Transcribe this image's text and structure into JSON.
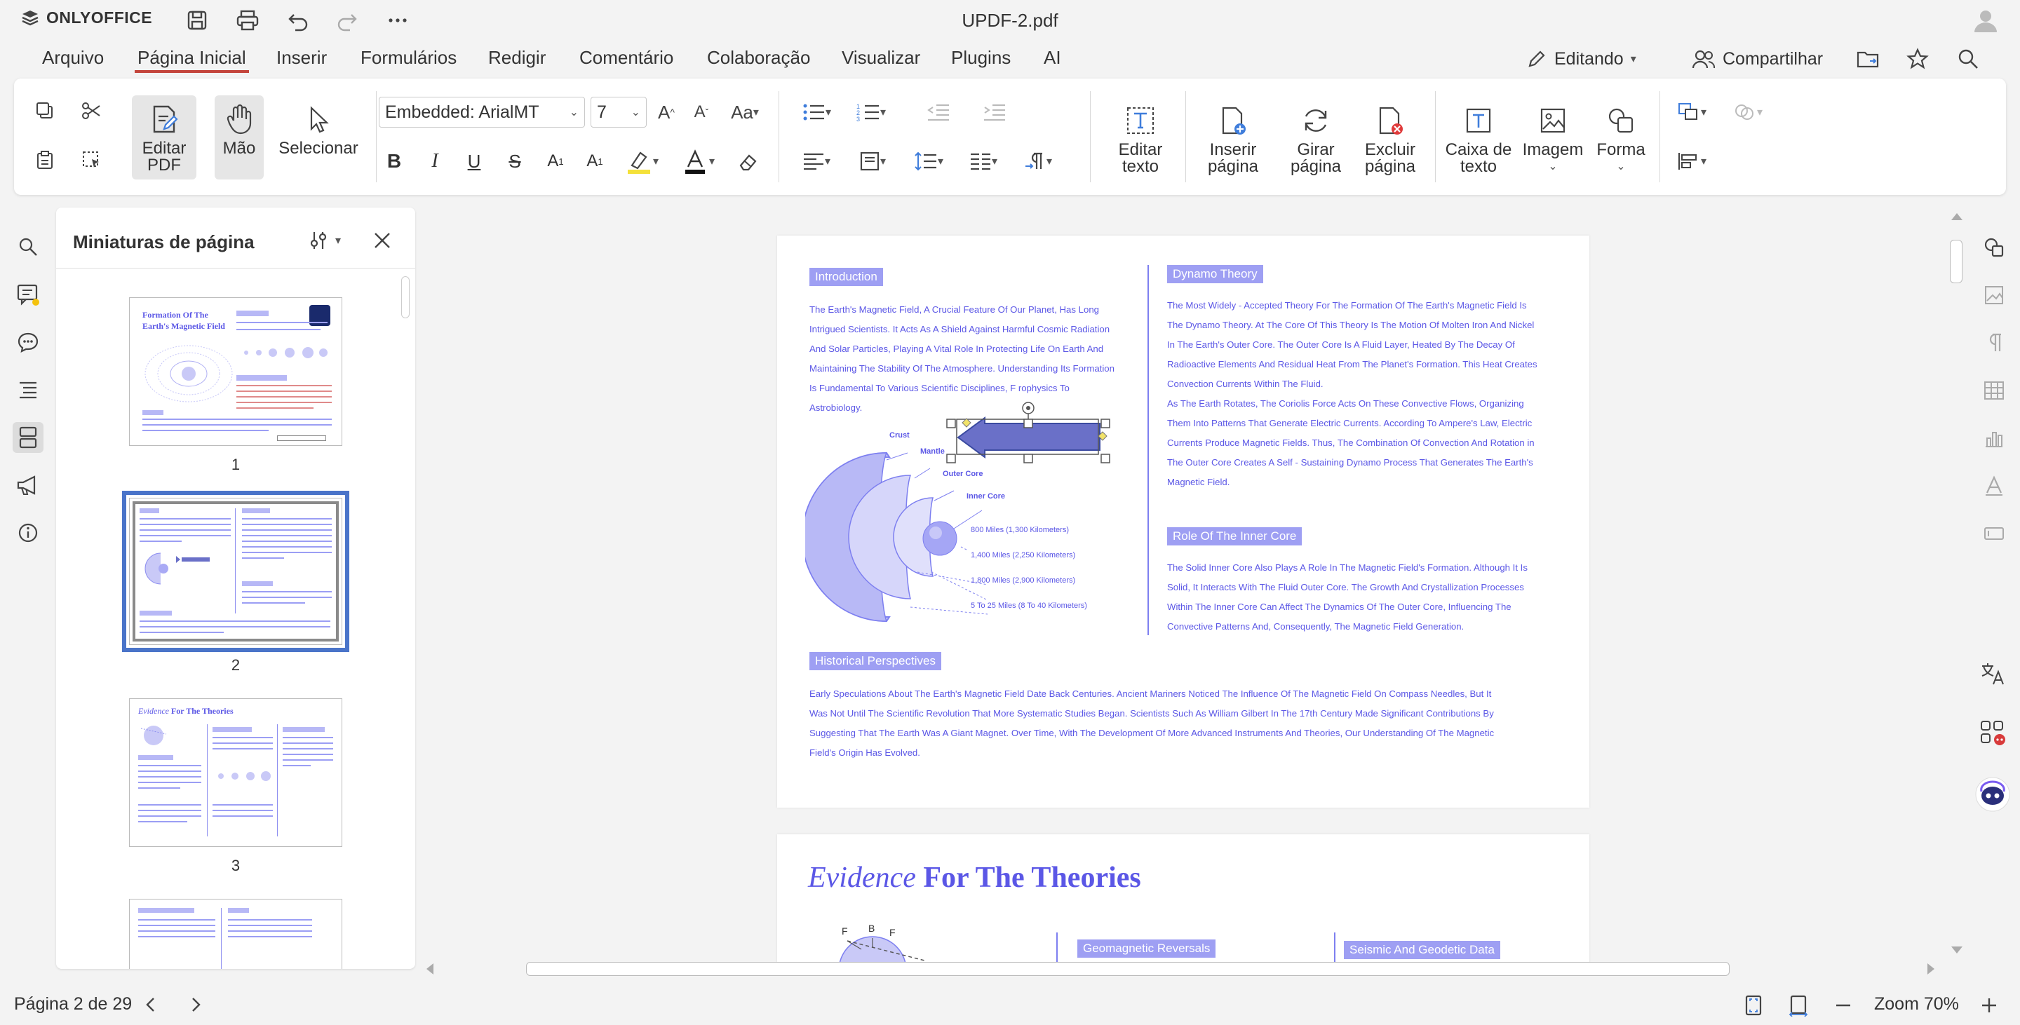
{
  "app": {
    "name": "ONLYOFFICE",
    "doc_title": "UPDF-2.pdf"
  },
  "menu": {
    "tabs": [
      "Arquivo",
      "Página Inicial",
      "Inserir",
      "Formulários",
      "Redigir",
      "Comentário",
      "Colaboração",
      "Visualizar",
      "Plugins",
      "AI"
    ],
    "active": "Página Inicial",
    "editing_label": "Editando",
    "share_label": "Compartilhar"
  },
  "ribbon": {
    "edit_pdf": "Editar PDF",
    "hand": "Mão",
    "select": "Selecionar",
    "font_name": "Embedded: ArialMT",
    "font_size": "7",
    "edit_text": "Editar texto",
    "insert_page": "Inserir página",
    "rotate_page": "Girar página",
    "delete_page": "Excluir página",
    "text_box": "Caixa de texto",
    "image": "Imagem",
    "shape": "Forma"
  },
  "thumbs": {
    "title": "Miniaturas de página",
    "pages": [
      "1",
      "2",
      "3"
    ],
    "selected": "2",
    "p1_title": "Formation Of The Earth's Magnetic Field",
    "p3_title_em": "Evidence",
    "p3_title_rest": " For The Theories"
  },
  "page2": {
    "intro_h": "Introduction",
    "intro_lines": [
      "The Earth's Magnetic Field, A Crucial Feature Of Our Planet, Has Long",
      "Intrigued Scientists. It Acts As A Shield Against Harmful Cosmic Radiation",
      "And Solar Particles, Playing A Vital Role In Protecting Life On Earth And",
      "Maintaining The Stability Of The Atmosphere. Understanding Its Formation",
      "Is Fundamental To Various Scientific Disciplines, F      rophysics To",
      "Astrobiology."
    ],
    "layers": {
      "crust": "Crust",
      "mantle": "Mantle",
      "outer_core": "Outer Core",
      "inner_core": "Inner Core"
    },
    "distances": [
      "800 Miles (1,300 Kilometers)",
      "1,400 Miles (2,250 Kilometers)",
      "1,800 Miles (2,900 Kilometers)",
      "5 To 25 Miles (8 To 40 Kilometers)"
    ],
    "dynamo_h": "Dynamo Theory",
    "dynamo_lines": [
      "The Most Widely - Accepted Theory For The Formation Of The Earth's Magnetic Field Is",
      "The Dynamo Theory. At The Core Of This Theory Is The Motion Of Molten Iron And Nickel",
      "In The Earth's Outer Core. The Outer Core Is A Fluid Layer, Heated By The Decay Of",
      "Radioactive Elements And Residual Heat From The Planet's Formation. This Heat Creates",
      "Convection Currents Within The Fluid.",
      "As The Earth Rotates, The Coriolis Force Acts On These Convective Flows, Organizing",
      "Them Into Patterns That Generate Electric Currents. According To Ampere's Law, Electric",
      "Currents Produce Magnetic Fields. Thus, The Combination Of Convection And Rotation in",
      "The Outer Core Creates A Self - Sustaining Dynamo Process That Generates The Earth's",
      "Magnetic Field."
    ],
    "inner_h": "Role Of The Inner Core",
    "inner_lines": [
      "The Solid Inner Core Also Plays A Role In The Magnetic Field's Formation. Although It Is",
      "Solid, It Interacts With The Fluid Outer Core. The Growth And Crystallization Processes",
      "Within The Inner Core Can Affect The Dynamics Of The Outer Core, Influencing The",
      "Convective Patterns And, Consequently, The Magnetic Field Generation."
    ],
    "hist_h": "Historical Perspectives",
    "hist_lines": [
      "Early Speculations About The Earth's Magnetic Field Date Back Centuries. Ancient Mariners Noticed The Influence Of The Magnetic Field On Compass Needles, But It",
      "Was Not Until The Scientific Revolution That More Systematic Studies Began. Scientists Such As William Gilbert In The 17th Century Made Significant Contributions By",
      "Suggesting That The Earth Was A Giant Magnet. Over Time, With The Development Of More Advanced Instruments And Theories, Our Understanding Of The Magnetic",
      "Field's Origin Has Evolved."
    ]
  },
  "page3": {
    "title_em": "Evidence",
    "title_rest": " For The Theories",
    "badge1": "Geomagnetic Reversals",
    "badge2": "Seismic And Geodetic Data",
    "force_labels": [
      "F",
      "B",
      "F"
    ]
  },
  "status": {
    "page_info": "Página 2 de 29",
    "zoom": "Zoom 70%"
  },
  "colors": {
    "accent_red": "#c4453c",
    "doc_purple": "#5b57e6",
    "badge_bg": "#9e9ff3",
    "select_blue": "#4a74c9"
  }
}
